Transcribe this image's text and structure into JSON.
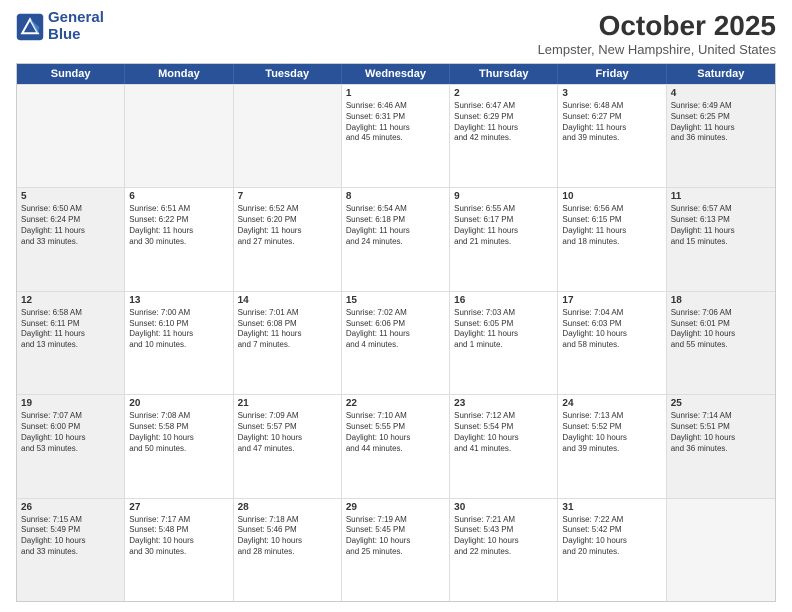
{
  "logo": {
    "line1": "General",
    "line2": "Blue"
  },
  "title": "October 2025",
  "location": "Lempster, New Hampshire, United States",
  "weekdays": [
    "Sunday",
    "Monday",
    "Tuesday",
    "Wednesday",
    "Thursday",
    "Friday",
    "Saturday"
  ],
  "rows": [
    [
      {
        "day": "",
        "text": "",
        "empty": true
      },
      {
        "day": "",
        "text": "",
        "empty": true
      },
      {
        "day": "",
        "text": "",
        "empty": true
      },
      {
        "day": "1",
        "text": "Sunrise: 6:46 AM\nSunset: 6:31 PM\nDaylight: 11 hours\nand 45 minutes.",
        "empty": false
      },
      {
        "day": "2",
        "text": "Sunrise: 6:47 AM\nSunset: 6:29 PM\nDaylight: 11 hours\nand 42 minutes.",
        "empty": false
      },
      {
        "day": "3",
        "text": "Sunrise: 6:48 AM\nSunset: 6:27 PM\nDaylight: 11 hours\nand 39 minutes.",
        "empty": false
      },
      {
        "day": "4",
        "text": "Sunrise: 6:49 AM\nSunset: 6:25 PM\nDaylight: 11 hours\nand 36 minutes.",
        "empty": false,
        "shaded": true
      }
    ],
    [
      {
        "day": "5",
        "text": "Sunrise: 6:50 AM\nSunset: 6:24 PM\nDaylight: 11 hours\nand 33 minutes.",
        "empty": false,
        "shaded": true
      },
      {
        "day": "6",
        "text": "Sunrise: 6:51 AM\nSunset: 6:22 PM\nDaylight: 11 hours\nand 30 minutes.",
        "empty": false
      },
      {
        "day": "7",
        "text": "Sunrise: 6:52 AM\nSunset: 6:20 PM\nDaylight: 11 hours\nand 27 minutes.",
        "empty": false
      },
      {
        "day": "8",
        "text": "Sunrise: 6:54 AM\nSunset: 6:18 PM\nDaylight: 11 hours\nand 24 minutes.",
        "empty": false
      },
      {
        "day": "9",
        "text": "Sunrise: 6:55 AM\nSunset: 6:17 PM\nDaylight: 11 hours\nand 21 minutes.",
        "empty": false
      },
      {
        "day": "10",
        "text": "Sunrise: 6:56 AM\nSunset: 6:15 PM\nDaylight: 11 hours\nand 18 minutes.",
        "empty": false
      },
      {
        "day": "11",
        "text": "Sunrise: 6:57 AM\nSunset: 6:13 PM\nDaylight: 11 hours\nand 15 minutes.",
        "empty": false,
        "shaded": true
      }
    ],
    [
      {
        "day": "12",
        "text": "Sunrise: 6:58 AM\nSunset: 6:11 PM\nDaylight: 11 hours\nand 13 minutes.",
        "empty": false,
        "shaded": true
      },
      {
        "day": "13",
        "text": "Sunrise: 7:00 AM\nSunset: 6:10 PM\nDaylight: 11 hours\nand 10 minutes.",
        "empty": false
      },
      {
        "day": "14",
        "text": "Sunrise: 7:01 AM\nSunset: 6:08 PM\nDaylight: 11 hours\nand 7 minutes.",
        "empty": false
      },
      {
        "day": "15",
        "text": "Sunrise: 7:02 AM\nSunset: 6:06 PM\nDaylight: 11 hours\nand 4 minutes.",
        "empty": false
      },
      {
        "day": "16",
        "text": "Sunrise: 7:03 AM\nSunset: 6:05 PM\nDaylight: 11 hours\nand 1 minute.",
        "empty": false
      },
      {
        "day": "17",
        "text": "Sunrise: 7:04 AM\nSunset: 6:03 PM\nDaylight: 10 hours\nand 58 minutes.",
        "empty": false
      },
      {
        "day": "18",
        "text": "Sunrise: 7:06 AM\nSunset: 6:01 PM\nDaylight: 10 hours\nand 55 minutes.",
        "empty": false,
        "shaded": true
      }
    ],
    [
      {
        "day": "19",
        "text": "Sunrise: 7:07 AM\nSunset: 6:00 PM\nDaylight: 10 hours\nand 53 minutes.",
        "empty": false,
        "shaded": true
      },
      {
        "day": "20",
        "text": "Sunrise: 7:08 AM\nSunset: 5:58 PM\nDaylight: 10 hours\nand 50 minutes.",
        "empty": false
      },
      {
        "day": "21",
        "text": "Sunrise: 7:09 AM\nSunset: 5:57 PM\nDaylight: 10 hours\nand 47 minutes.",
        "empty": false
      },
      {
        "day": "22",
        "text": "Sunrise: 7:10 AM\nSunset: 5:55 PM\nDaylight: 10 hours\nand 44 minutes.",
        "empty": false
      },
      {
        "day": "23",
        "text": "Sunrise: 7:12 AM\nSunset: 5:54 PM\nDaylight: 10 hours\nand 41 minutes.",
        "empty": false
      },
      {
        "day": "24",
        "text": "Sunrise: 7:13 AM\nSunset: 5:52 PM\nDaylight: 10 hours\nand 39 minutes.",
        "empty": false
      },
      {
        "day": "25",
        "text": "Sunrise: 7:14 AM\nSunset: 5:51 PM\nDaylight: 10 hours\nand 36 minutes.",
        "empty": false,
        "shaded": true
      }
    ],
    [
      {
        "day": "26",
        "text": "Sunrise: 7:15 AM\nSunset: 5:49 PM\nDaylight: 10 hours\nand 33 minutes.",
        "empty": false,
        "shaded": true
      },
      {
        "day": "27",
        "text": "Sunrise: 7:17 AM\nSunset: 5:48 PM\nDaylight: 10 hours\nand 30 minutes.",
        "empty": false
      },
      {
        "day": "28",
        "text": "Sunrise: 7:18 AM\nSunset: 5:46 PM\nDaylight: 10 hours\nand 28 minutes.",
        "empty": false
      },
      {
        "day": "29",
        "text": "Sunrise: 7:19 AM\nSunset: 5:45 PM\nDaylight: 10 hours\nand 25 minutes.",
        "empty": false
      },
      {
        "day": "30",
        "text": "Sunrise: 7:21 AM\nSunset: 5:43 PM\nDaylight: 10 hours\nand 22 minutes.",
        "empty": false
      },
      {
        "day": "31",
        "text": "Sunrise: 7:22 AM\nSunset: 5:42 PM\nDaylight: 10 hours\nand 20 minutes.",
        "empty": false
      },
      {
        "day": "",
        "text": "",
        "empty": true,
        "shaded": true
      }
    ]
  ]
}
